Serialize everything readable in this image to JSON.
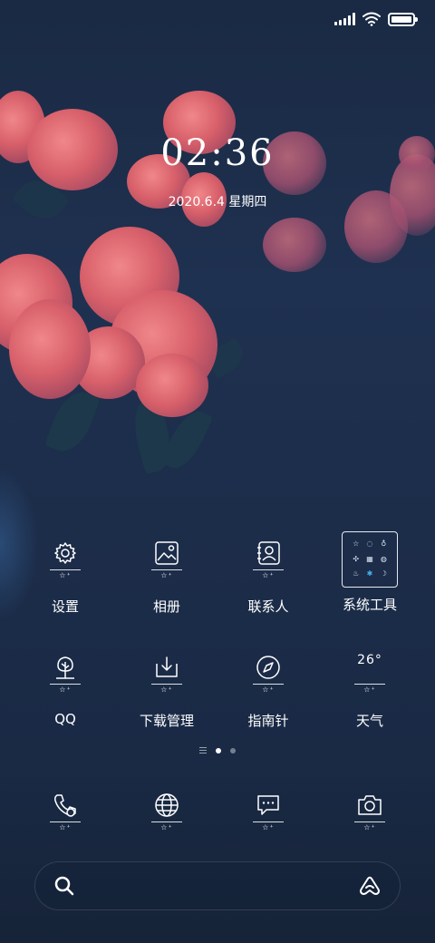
{
  "status_bar": {
    "signal_icon": "signal-icon",
    "wifi_icon": "wifi-icon",
    "battery_icon": "battery-icon",
    "battery_level": 1.0
  },
  "clock": {
    "time": "02:36",
    "date": "2020.6.4 星期四"
  },
  "apps_row1": [
    {
      "label": "设置",
      "icon": "gear-icon"
    },
    {
      "label": "相册",
      "icon": "gallery-icon"
    },
    {
      "label": "联系人",
      "icon": "contacts-icon"
    },
    {
      "label": "系统工具",
      "icon": "folder-icon"
    }
  ],
  "apps_row2": [
    {
      "label": "QQ",
      "icon": "tree-icon"
    },
    {
      "label": "下载管理",
      "icon": "download-icon"
    },
    {
      "label": "指南针",
      "icon": "compass-icon"
    },
    {
      "label": "天气",
      "icon": "weather-icon",
      "temperature": "26°"
    }
  ],
  "page_indicator": {
    "pages": 2,
    "active": 0
  },
  "dock": [
    {
      "icon": "phone-icon"
    },
    {
      "icon": "browser-icon"
    },
    {
      "icon": "message-icon"
    },
    {
      "icon": "camera-icon"
    }
  ],
  "search": {
    "search_icon": "search-icon",
    "assistant_icon": "assistant-icon"
  },
  "colors": {
    "background": "#1c2d4a",
    "flower": "#d8606a",
    "accent_blue": "#46b4f0",
    "text": "#ffffff"
  }
}
